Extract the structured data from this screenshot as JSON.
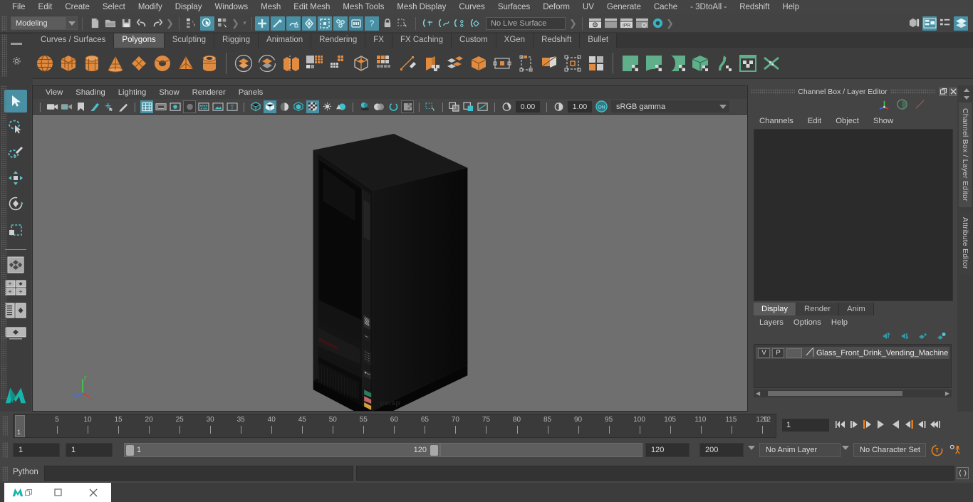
{
  "app": {
    "title": "Autodesk Maya"
  },
  "menubar": {
    "items": [
      "File",
      "Edit",
      "Create",
      "Select",
      "Modify",
      "Display",
      "Windows",
      "Mesh",
      "Edit Mesh",
      "Mesh Tools",
      "Mesh Display",
      "Curves",
      "Surfaces",
      "Deform",
      "UV",
      "Generate",
      "Cache",
      "- 3DtoAll -",
      "Redshift",
      "Help"
    ]
  },
  "statusbar": {
    "menuset": "Modeling",
    "live_surface": "No Live Surface",
    "icons": [
      "new-scene-icon",
      "open-scene-icon",
      "save-scene-icon",
      "undo-icon",
      "redo-icon",
      "select-hierarchy-icon",
      "select-object-icon",
      "select-component-icon",
      "snap-grid-icon",
      "snap-curve-icon",
      "snap-point-icon",
      "snap-view-plane-icon",
      "snap-projected-center-icon",
      "snap-construction-plane-icon",
      "snap-pivot-icon",
      "lock-icon",
      "select-by-type-icon",
      "render-current-frame-icon",
      "ipr-render-icon",
      "render-settings-icon",
      "hypershade-icon",
      "show-hide-modeling-toolkit-icon",
      "show-attribute-editor-icon",
      "show-tool-settings-icon",
      "show-channel-box-icon"
    ]
  },
  "shelf": {
    "tabs": [
      "Curves / Surfaces",
      "Polygons",
      "Sculpting",
      "Rigging",
      "Animation",
      "Rendering",
      "FX",
      "FX Caching",
      "Custom",
      "XGen",
      "Redshift",
      "Bullet"
    ],
    "active_tab": "Polygons",
    "icons": [
      "poly-sphere-icon",
      "poly-cube-icon",
      "poly-cylinder-icon",
      "poly-cone-icon",
      "poly-plane-icon",
      "poly-torus-icon",
      "poly-pyramid-icon",
      "poly-pipe-icon",
      "poly-boolean-union-icon",
      "poly-boolean-difference-icon",
      "poly-combine-icon",
      "poly-smooth-icon",
      "poly-extrude-icon",
      "poly-bevel-icon",
      "poly-bridge-icon",
      "poly-multi-cut-icon",
      "poly-target-weld-icon",
      "poly-quad-draw-icon",
      "poly-merge-icon",
      "poly-append-icon",
      "poly-insert-edge-loop-icon",
      "poly-offset-edge-loop-icon",
      "poly-connect-icon",
      "poly-crease-icon",
      "poly-mirror-icon",
      "uv-planar-icon",
      "uv-cylindrical-icon",
      "uv-spherical-icon",
      "uv-automatic-icon",
      "uv-unfold-icon",
      "uv-editor-icon",
      "uv-cut-sew-icon"
    ]
  },
  "toolbox": {
    "items": [
      {
        "name": "select-tool",
        "selected": true
      },
      {
        "name": "lasso-select-tool",
        "selected": false
      },
      {
        "name": "paint-select-tool",
        "selected": false
      },
      {
        "name": "move-tool",
        "selected": false
      },
      {
        "name": "rotate-tool",
        "selected": false
      },
      {
        "name": "scale-tool",
        "selected": false
      },
      {
        "name": "last-tool-used",
        "selected": false
      },
      {
        "name": "single-pane-layout",
        "selected": false
      },
      {
        "name": "two-pane-layout",
        "selected": false
      },
      {
        "name": "outliner-persp-layout",
        "selected": false
      },
      {
        "name": "persp-layout",
        "selected": false
      },
      {
        "name": "maya-logo",
        "selected": false
      }
    ]
  },
  "viewport": {
    "menu": [
      "View",
      "Shading",
      "Lighting",
      "Show",
      "Renderer",
      "Panels"
    ],
    "exposure_value": "0.00",
    "gamma_value": "1.00",
    "color_space": "sRGB gamma",
    "gamma_toggle": "ON",
    "camera_label": "persp",
    "axis_labels": {
      "x": "x",
      "y": "y",
      "z": "z"
    },
    "background_color": "#6f6f6f",
    "model_name": "Glass Front Drink Vending Machine",
    "toolbar_icons": [
      "select-camera-icon",
      "camera-attributes-icon",
      "bookmark-icon",
      "image-plane-icon",
      "two-d-pan-zoom-icon",
      "grease-pencil-icon",
      "grid-toggle-icon",
      "film-gate-icon",
      "resolution-gate-icon",
      "gate-mask-icon",
      "film-origin-icon",
      "safe-action-icon",
      "safe-title-icon",
      "wireframe-icon",
      "smooth-shade-all-icon",
      "shaded-wireframe-icon",
      "textured-icon",
      "use-default-material-icon",
      "xray-icon",
      "xray-joints-icon",
      "lighting-default-icon",
      "lighting-all-icon",
      "shadows-icon",
      "screen-space-ao-icon",
      "motion-blur-icon",
      "multisample-aa-icon",
      "depth-of-field-icon",
      "isolate-select-icon",
      "grid-display-icon",
      "film-gate-display-icon",
      "image-plane-display-icon",
      "exposure-icon",
      "gamma-icon",
      "color-management-icon"
    ]
  },
  "channelbox": {
    "title": "Channel Box / Layer Editor",
    "window_buttons": [
      "undock-icon",
      "close-icon"
    ],
    "header_icons": [
      "transform-axis-icon",
      "rotate-dial-icon",
      "slider-icon"
    ],
    "menu": [
      "Channels",
      "Edit",
      "Object",
      "Show"
    ],
    "contents": ""
  },
  "layereditor": {
    "tabs": [
      "Display",
      "Render",
      "Anim"
    ],
    "active_tab": "Display",
    "menu": [
      "Layers",
      "Options",
      "Help"
    ],
    "tool_icons": [
      "move-layer-up-icon",
      "move-layer-down-icon",
      "create-new-layer-icon",
      "create-layer-from-selection-icon"
    ],
    "layers": [
      {
        "visibility": "V",
        "playback": "P",
        "color": "#5c5c5c",
        "name": "Glass_Front_Drink_Vending_Machine"
      }
    ]
  },
  "rightTabs": [
    "Channel Box / Layer Editor",
    "Attribute Editor"
  ],
  "timeline": {
    "ticks": [
      5,
      10,
      15,
      20,
      25,
      30,
      35,
      40,
      45,
      50,
      55,
      60,
      65,
      70,
      75,
      80,
      85,
      90,
      95,
      100,
      105,
      110,
      115,
      120
    ],
    "partial_last_tick": "12",
    "current_frame_marker": "1",
    "current_frame_field": "1",
    "playback_buttons": [
      "go-to-start-icon",
      "step-back-frame-icon",
      "step-back-key-icon",
      "play-backwards-icon",
      "play-forwards-icon",
      "step-forward-key-icon",
      "step-forward-frame-icon",
      "go-to-end-icon"
    ]
  },
  "rangeslider": {
    "anim_start": "1",
    "range_start": "1",
    "range_bar_low": "1",
    "range_bar_high": "120",
    "range_end": "120",
    "anim_end": "200",
    "anim_layer": "No Anim Layer",
    "character_set": "No Character Set",
    "buttons": [
      "auto-key-icon",
      "animation-preferences-icon"
    ]
  },
  "commandline": {
    "language_label": "Python",
    "input_value": "",
    "output_value": "",
    "script_editor_icon": "script-editor-icon"
  },
  "taskbar": {
    "buttons": [
      "maya-app-icon",
      "restore-window-icon",
      "maximize-window-icon",
      "close-window-icon"
    ]
  },
  "colors": {
    "accent_blue": "#4a90a4",
    "shelf_orange": "#e08b40",
    "shelf_green": "#5fb08a",
    "panel_bg": "#444444",
    "viewport_bg": "#6f6f6f",
    "highlight_orange": "#e8821e"
  }
}
